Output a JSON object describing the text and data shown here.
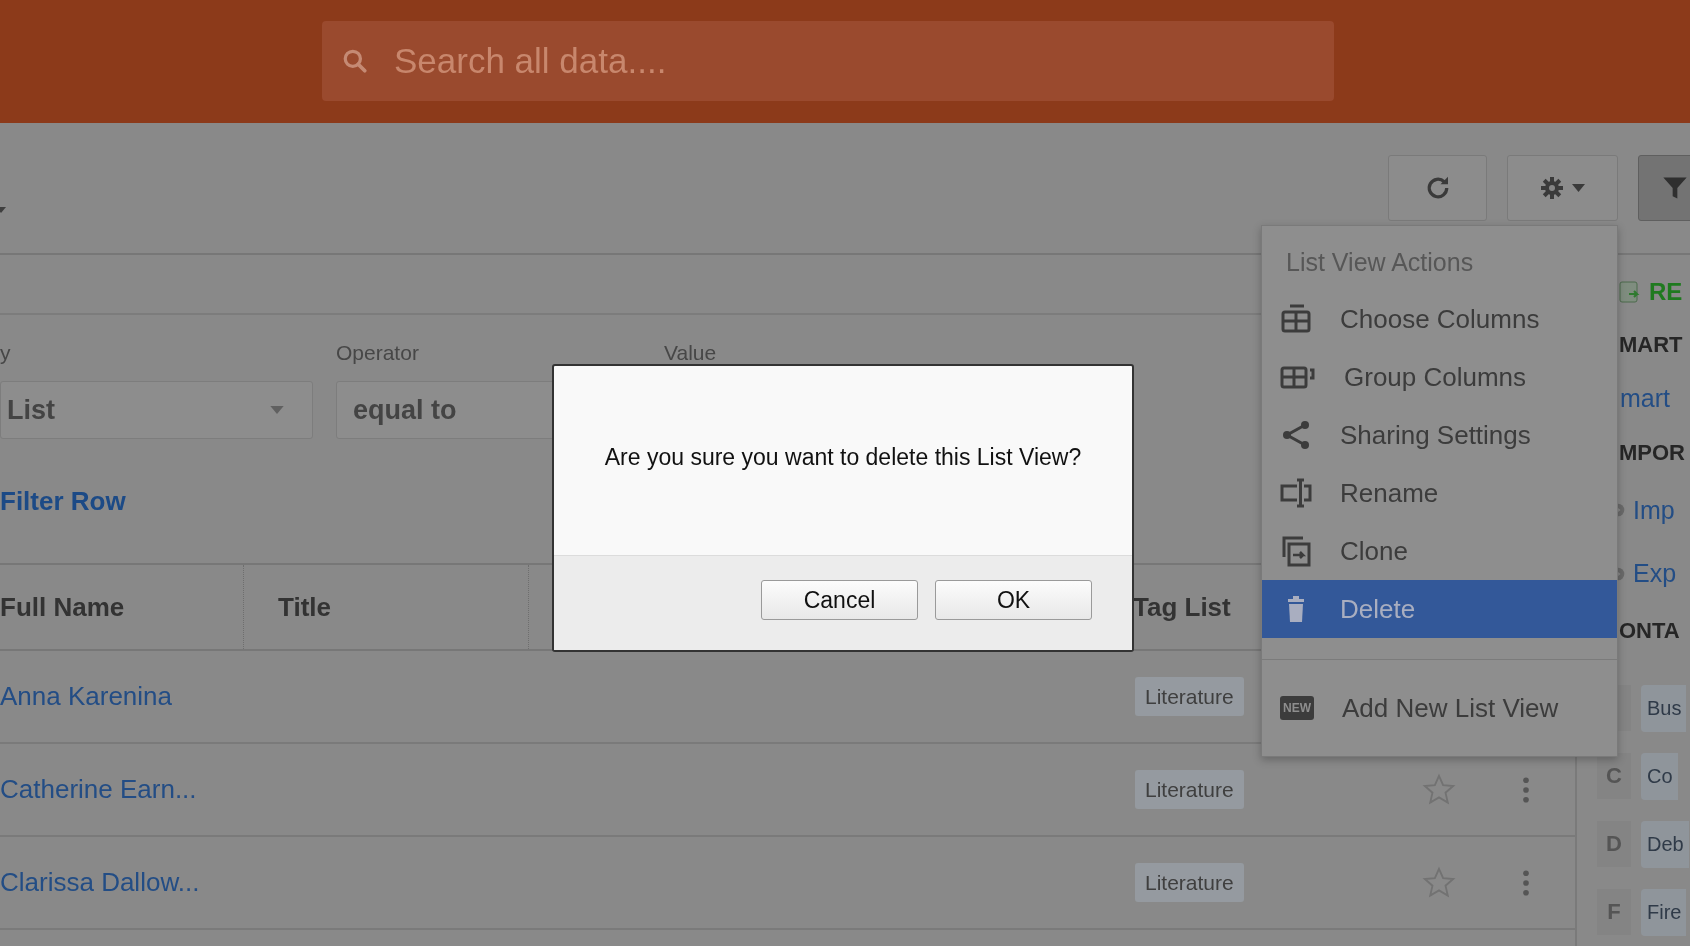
{
  "header": {
    "search": {
      "placeholder": "Search all data...."
    }
  },
  "filter": {
    "field_label": "y",
    "field_value": "List",
    "operator_label": "Operator",
    "operator_value": "equal to",
    "value_label": "Value",
    "link": "Filter Row"
  },
  "table": {
    "columns": [
      "Full Name",
      "Title",
      "Tag List"
    ],
    "rows": [
      {
        "name": "Anna Karenina",
        "tag": "Literature"
      },
      {
        "name": "Catherine Earn...",
        "tag": "Literature"
      },
      {
        "name": "Clarissa Dallow...",
        "tag": "Literature"
      }
    ]
  },
  "side_panel": {
    "recent": "RE",
    "smart_heading": "MART",
    "smart_link": "mart",
    "import_heading": "MPOR",
    "import_links": [
      "Imp",
      "Exp"
    ],
    "contacts_heading": "ONTA",
    "contact_groups": [
      {
        "label": "Bus"
      },
      {
        "letter": "C",
        "label": "Co"
      },
      {
        "letter": "D",
        "label": "Deb"
      },
      {
        "letter": "F",
        "label": "Fire"
      }
    ]
  },
  "menu": {
    "title": "List View Actions",
    "items": [
      {
        "label": "Choose Columns",
        "selected": false
      },
      {
        "label": "Group Columns",
        "selected": false
      },
      {
        "label": "Sharing Settings",
        "selected": false
      },
      {
        "label": "Rename",
        "selected": false
      },
      {
        "label": "Clone",
        "selected": false
      },
      {
        "label": "Delete",
        "selected": true
      }
    ],
    "add_item": {
      "label": "Add New List View",
      "badge": "NEW"
    }
  },
  "dialog": {
    "message": "Are you sure you want to delete this List View?",
    "buttons": [
      "Cancel",
      "OK"
    ]
  }
}
